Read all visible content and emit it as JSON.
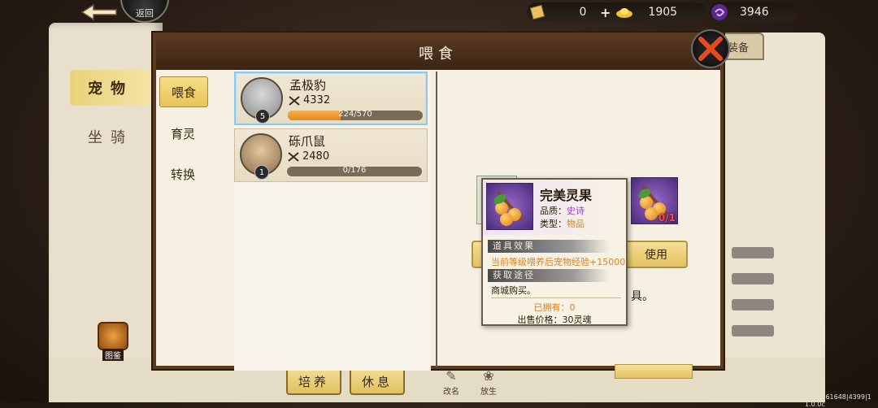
{
  "topbar": {
    "return_label": "返回",
    "currency_1_value": "0",
    "plus_symbol": "+",
    "currency_2_value": "1905",
    "currency_3_value": "3946"
  },
  "book": {
    "tabs": [
      "宠物",
      "坐骑"
    ],
    "equip_tab": "装备",
    "codex_label": "图鉴",
    "bottom_buttons": [
      "培养",
      "休息"
    ],
    "bottom_icons": [
      "改名",
      "放生"
    ]
  },
  "dialog": {
    "title": "喂食",
    "sub_tabs": [
      "喂食",
      "育灵",
      "转换"
    ],
    "pets": [
      {
        "name": "孟极豹",
        "level": "5",
        "power": "4332",
        "exp_text": "224/570",
        "exp_fraction": 0.393
      },
      {
        "name": "砾爪鼠",
        "level": "1",
        "power": "2480",
        "exp_text": "0/176",
        "exp_fraction": 0.0
      }
    ],
    "item_count": "0/1",
    "use_button": "使用",
    "partial_char": "具。"
  },
  "tooltip": {
    "name": "完美灵果",
    "quality_label": "品质：",
    "quality_value": "史诗",
    "type_label": "类型：",
    "type_value": "物品",
    "effect_header": "道具效果",
    "effect_text": "当前等级喂养后宠物经验+15000",
    "source_header": "获取途径",
    "source_text": "商城购买。",
    "owned_text": "已拥有：0",
    "price_text": "出售价格：30灵魂"
  },
  "version_text": "1739561648|4399|1 1.0.0c",
  "colors": {
    "accent_gold": "#e8c458",
    "epic_purple": "#9a3ad0",
    "orange_text": "#d28420",
    "exp_bar": "#e08a20"
  }
}
